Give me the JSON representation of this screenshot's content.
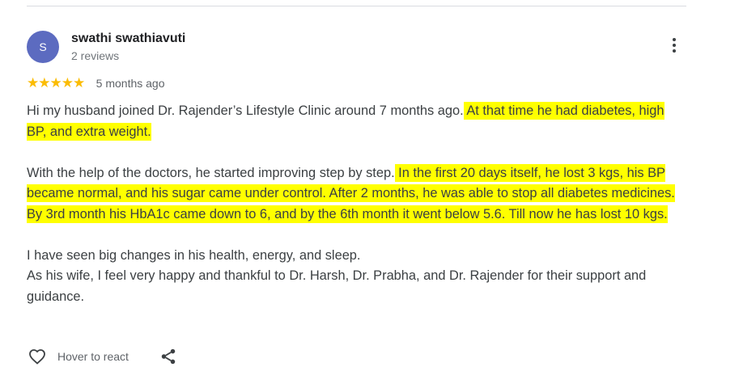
{
  "reviewer": {
    "avatar_letter": "S",
    "name": "swathi swathiavuti",
    "reviews_count": "2 reviews"
  },
  "rating": {
    "stars": 5,
    "stars_text": "★★★★★",
    "time_ago": "5 months ago"
  },
  "review": {
    "p1_plain": "Hi my husband joined Dr. Rajender’s Lifestyle Clinic around 7 months ago.",
    "p1_highlight": " At that time he had diabetes, high BP, and extra weight.",
    "p2_plain": "With the help of the doctors, he started improving step by step.",
    "p2_highlight": " In the first 20 days itself, he lost 3 kgs, his BP became normal, and his sugar came under control. After 2 months, he was able to stop all diabetes medicines. By 3rd month his HbA1c came down to 6, and by the 6th month it went below 5.6. Till now he has lost 10 kgs.",
    "p3_line1": "I have seen big changes in his health, energy, and sleep.",
    "p3_line2": "As his wife, I feel very happy and thankful to Dr. Harsh, Dr. Prabha, and Dr. Rajender for their support and guidance."
  },
  "actions": {
    "react_label": "Hover to react"
  },
  "colors": {
    "highlight": "#ffff00",
    "star": "#fbbc04",
    "avatar_bg": "#5c6bc0"
  },
  "icons": [
    "more-vert-icon",
    "star-icon",
    "heart-icon",
    "share-icon"
  ]
}
